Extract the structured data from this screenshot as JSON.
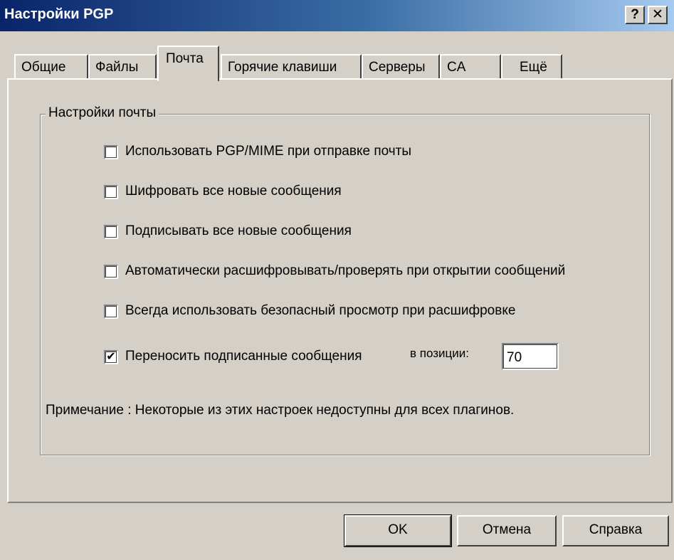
{
  "window": {
    "title": "Настройки PGP",
    "help_label": "?",
    "close_label": "✕"
  },
  "tabs": [
    {
      "label": "Общие"
    },
    {
      "label": "Файлы"
    },
    {
      "label": "Почта"
    },
    {
      "label": "Горячие клавиши"
    },
    {
      "label": "Серверы"
    },
    {
      "label": "CA"
    },
    {
      "label": "Ещё"
    }
  ],
  "active_tab": "Почта",
  "mail_settings": {
    "group_title": "Настройки почты",
    "options": [
      {
        "label": "Использовать PGP/MIME при отправке почты",
        "checked": false
      },
      {
        "label": "Шифровать все новые сообщения",
        "checked": false
      },
      {
        "label": "Подписывать все новые сообщения",
        "checked": false
      },
      {
        "label": "Автоматически расшифровывать/проверять при открытии сообщений",
        "checked": false
      },
      {
        "label": "Всегда использовать безопасный просмотр при расшифровке",
        "checked": false
      },
      {
        "label": "Переносить подписанные сообщения",
        "checked": true
      }
    ],
    "wrap_position_label": "в позиции:",
    "wrap_position_value": "70",
    "note": "Примечание :  Некоторые из этих настроек недоступны для всех плагинов."
  },
  "buttons": {
    "ok": "OK",
    "cancel": "Отмена",
    "help": "Справка"
  }
}
